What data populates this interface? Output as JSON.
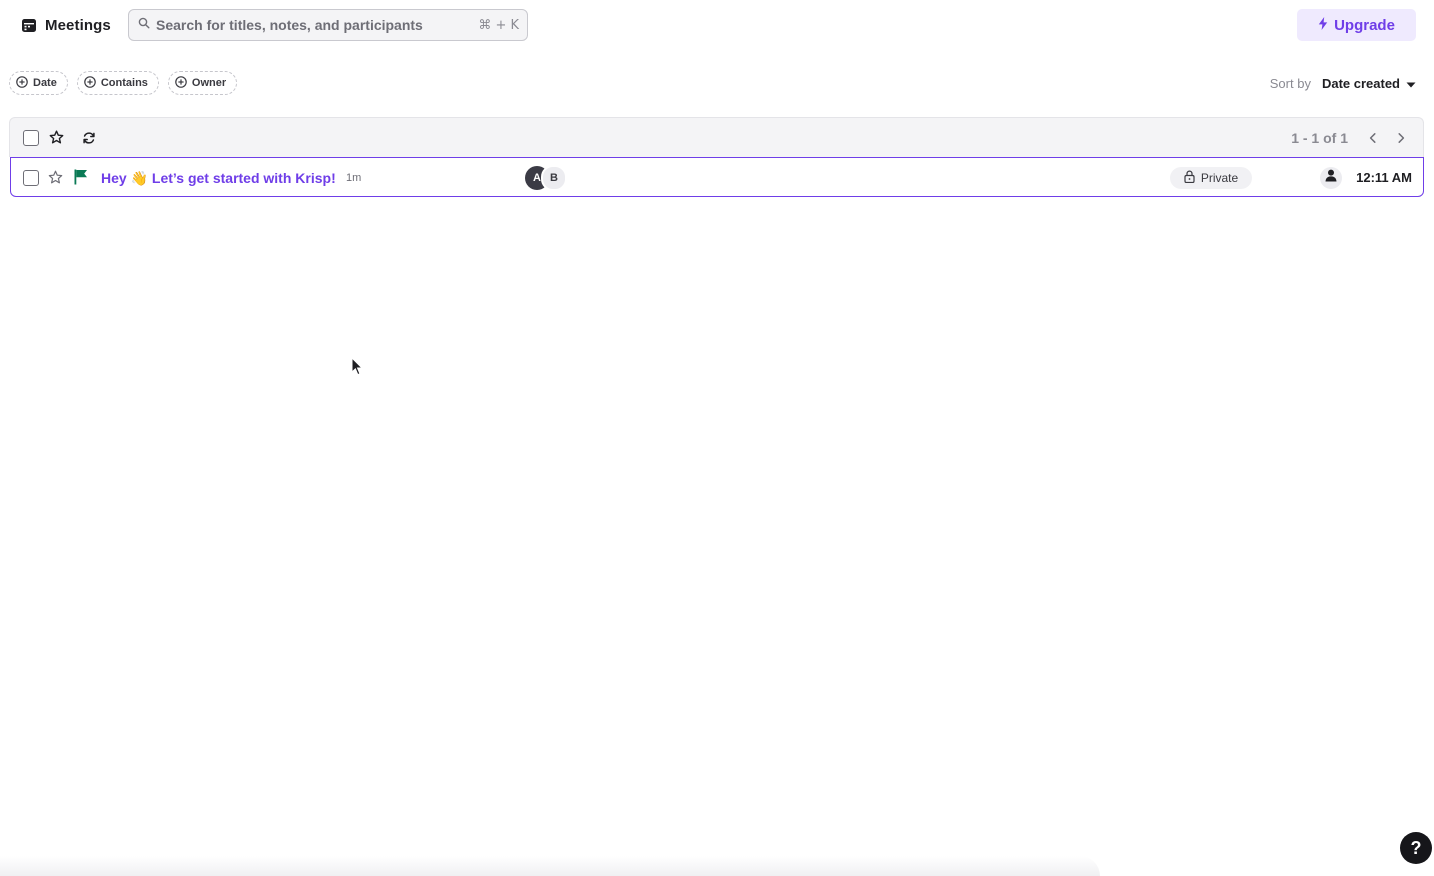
{
  "header": {
    "title": "Meetings",
    "title_icon": "calendar-icon",
    "search": {
      "placeholder": "Search for titles, notes, and participants",
      "value": "",
      "shortcut": "⌘ + K"
    },
    "upgrade_label": "Upgrade"
  },
  "filters": {
    "chips": [
      {
        "label": "Date",
        "icon": "plus-circle-icon"
      },
      {
        "label": "Contains",
        "icon": "plus-circle-icon"
      },
      {
        "label": "Owner",
        "icon": "plus-circle-icon"
      }
    ],
    "sort_label": "Sort by",
    "sort_value": "Date created"
  },
  "table": {
    "pagination": "1 - 1 of 1",
    "rows": [
      {
        "title": "Hey 👋 Let’s get started with Krisp!",
        "duration": "1m",
        "participants": [
          "A",
          "B"
        ],
        "visibility": "Private",
        "time": "12:11 AM",
        "flag_color": "#0a7a55"
      }
    ]
  },
  "help_label": "?",
  "colors": {
    "accent": "#6f3ee8",
    "accent_bg": "#efeafe",
    "flag": "#0a7a55"
  }
}
